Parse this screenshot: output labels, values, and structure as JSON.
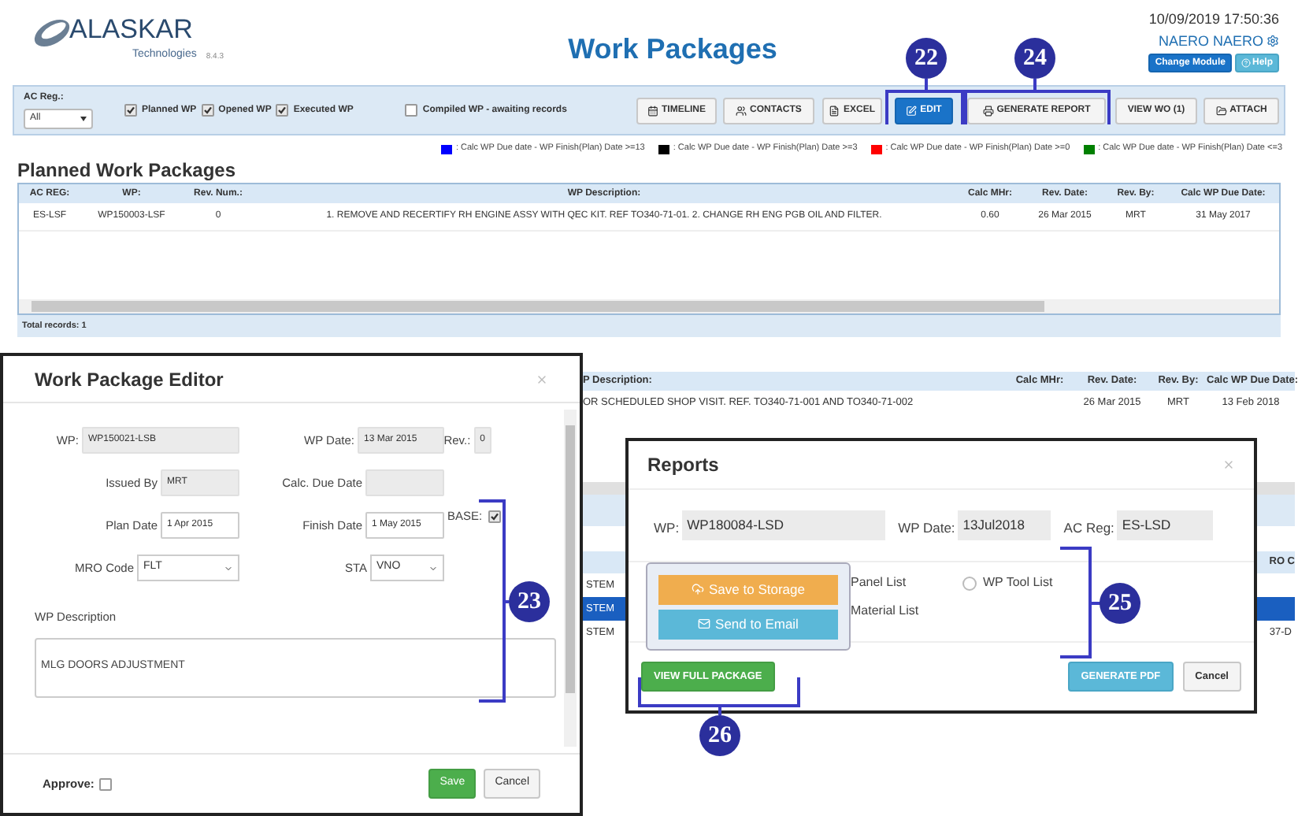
{
  "header": {
    "brand": "ALASKAR",
    "brand_sub": "Technologies",
    "version": "8.4.3",
    "title": "Work Packages",
    "datetime": "10/09/2019 17:50:36",
    "user": "NAERO NAERO",
    "buttons": [
      {
        "label": "Change Module",
        "kind": "primary"
      },
      {
        "label": "Help",
        "kind": "info"
      }
    ]
  },
  "toolbar": {
    "ac_reg_label": "AC Reg.:",
    "ac_reg_value": "All",
    "filters": [
      {
        "label": "Planned WP",
        "checked": true
      },
      {
        "label": "Opened WP",
        "checked": true
      },
      {
        "label": "Executed WP",
        "checked": true
      },
      {
        "label": "Compiled WP - awaiting records",
        "checked": false
      }
    ],
    "buttons": [
      {
        "label": "TIMELINE",
        "kind": "default"
      },
      {
        "label": "CONTACTS",
        "kind": "default"
      },
      {
        "label": "EXCEL",
        "kind": "default"
      },
      {
        "label": "EDIT",
        "kind": "primary"
      },
      {
        "label": "GENERATE REPORT",
        "kind": "default"
      },
      {
        "label": "VIEW WO (1)",
        "kind": "default"
      },
      {
        "label": "ATTACH",
        "kind": "default"
      }
    ]
  },
  "legend": [
    {
      "color": "#0000ff",
      "label": ": Calc WP Due date - WP Finish(Plan) Date >=13"
    },
    {
      "color": "#000000",
      "label": ": Calc WP Due date - WP Finish(Plan) Date >=3"
    },
    {
      "color": "#ff0000",
      "label": ": Calc WP Due date - WP Finish(Plan) Date >=0"
    },
    {
      "color": "#008000",
      "label": ": Calc WP Due date - WP Finish(Plan) Date <=3"
    }
  ],
  "planned": {
    "heading": "Planned Work Packages",
    "columns": [
      "AC REG:",
      "WP:",
      "Rev. Num.:",
      "WP Description:",
      "Calc MHr:",
      "Rev. Date:",
      "Rev. By:",
      "Calc WP Due Date:"
    ],
    "rows": [
      [
        "ES-LSF",
        "WP150003-LSF",
        "0",
        "1. REMOVE AND RECERTIFY RH ENGINE ASSY WITH QEC KIT. REF TO340-71-01. 2. CHANGE RH ENG PGB OIL AND FILTER.",
        "0.60",
        "26 Mar 2015",
        "MRT",
        "31 May 2017"
      ]
    ],
    "total": "Total records: 1"
  },
  "background_table": {
    "columns": [
      "P Description:",
      "Calc MHr:",
      "Rev. Date:",
      "Rev. By:",
      "Calc WP Due Date:"
    ],
    "row": [
      "OR SCHEDULED SHOP VISIT. REF. TO340-71-001 AND TO340-71-002",
      "26 Mar 2015",
      "MRT",
      "13 Feb 2018"
    ],
    "lower_header_right": "RO C",
    "lower_rows": [
      {
        "left": "STEM",
        "selected": false
      },
      {
        "left": "STEM",
        "selected": true
      },
      {
        "left": "STEM",
        "right": "37-D",
        "selected": false
      }
    ]
  },
  "editor": {
    "title": "Work Package Editor",
    "rows": [
      [
        {
          "label": "WP:",
          "value": "WP150021-LSB",
          "kind": "readonly"
        },
        {
          "label": "WP Date:",
          "value": "13 Mar 2015",
          "kind": "readonly"
        },
        {
          "label": "Rev.:",
          "value": "0",
          "kind": "readonly"
        }
      ],
      [
        {
          "label": "Issued By",
          "value": "MRT",
          "kind": "readonly"
        },
        {
          "label": "Calc. Due Date",
          "kind": "readonly"
        }
      ],
      [
        {
          "label": "Plan Date",
          "value": "1 Apr 2015",
          "kind": "input"
        },
        {
          "label": "Finish Date",
          "value": "1 May 2015",
          "kind": "input"
        },
        {
          "label": "BASE:",
          "checked": true,
          "kind": "checkbox"
        }
      ],
      [
        {
          "label": "MRO Code",
          "value": "FLT",
          "kind": "select"
        },
        {
          "label": "STA",
          "value": "VNO",
          "kind": "select"
        }
      ]
    ],
    "description_label": "WP Description",
    "description": "MLG DOORS ADJUSTMENT",
    "approve": {
      "label": "Approve:",
      "checked": false
    },
    "buttons": [
      {
        "label": "Save",
        "kind": "success"
      },
      {
        "label": "Cancel",
        "kind": "default"
      }
    ]
  },
  "reports": {
    "title": "Reports",
    "fields": [
      {
        "label": "WP:",
        "value": "WP180084-LSD"
      },
      {
        "label": "WP Date:",
        "value": "13Jul2018"
      },
      {
        "label": "AC Reg:",
        "value": "ES-LSD"
      }
    ],
    "popover": [
      {
        "label": "Save to Storage",
        "kind": "storage"
      },
      {
        "label": "Send to Email",
        "kind": "email"
      }
    ],
    "list_texts": [
      "Panel List",
      "Material List"
    ],
    "options": [
      {
        "label": "WP Tool List",
        "selected": false
      }
    ],
    "footer_buttons": [
      {
        "label": "VIEW FULL PACKAGE",
        "kind": "success"
      },
      {
        "label": "GENERATE PDF",
        "kind": "info"
      },
      {
        "label": "Cancel",
        "kind": "default"
      }
    ]
  },
  "callouts": [
    {
      "label": "22"
    },
    {
      "label": "24"
    },
    {
      "label": "23"
    },
    {
      "label": "25"
    },
    {
      "label": "26"
    }
  ]
}
